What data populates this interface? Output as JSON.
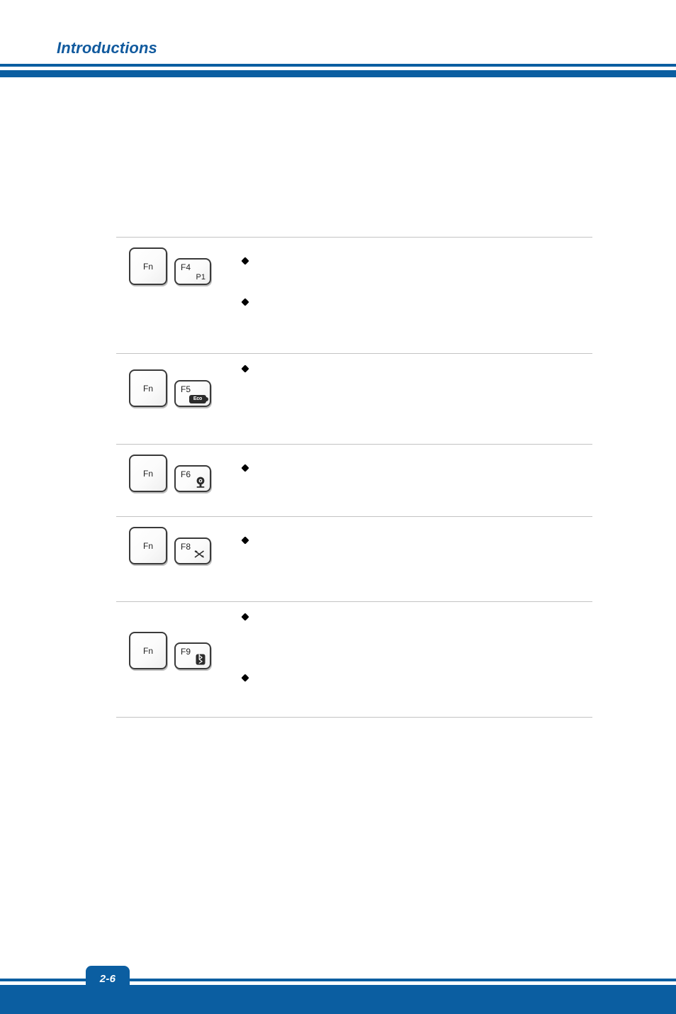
{
  "header": {
    "title": "Introductions",
    "accent_color": "#0b5ea1"
  },
  "footer": {
    "page_number": "2-6",
    "accent_color": "#0b5ea1"
  },
  "hotkey_table": {
    "rows": [
      {
        "modifier_key": "Fn",
        "function_key": "F4",
        "function_key_sub": "P1",
        "function_key_icon": "",
        "descriptions": [
          "",
          ""
        ]
      },
      {
        "modifier_key": "Fn",
        "function_key": "F5",
        "function_key_sub": "",
        "function_key_icon": "eco-battery-icon",
        "icon_label": "Eco",
        "descriptions": [
          ""
        ]
      },
      {
        "modifier_key": "Fn",
        "function_key": "F6",
        "function_key_sub": "",
        "function_key_icon": "webcam-icon",
        "descriptions": [
          ""
        ]
      },
      {
        "modifier_key": "Fn",
        "function_key": "F8",
        "function_key_sub": "",
        "function_key_icon": "wireless-lan-icon",
        "descriptions": [
          ""
        ]
      },
      {
        "modifier_key": "Fn",
        "function_key": "F9",
        "function_key_sub": "",
        "function_key_icon": "bluetooth-icon",
        "descriptions": [
          "",
          ""
        ]
      }
    ]
  }
}
